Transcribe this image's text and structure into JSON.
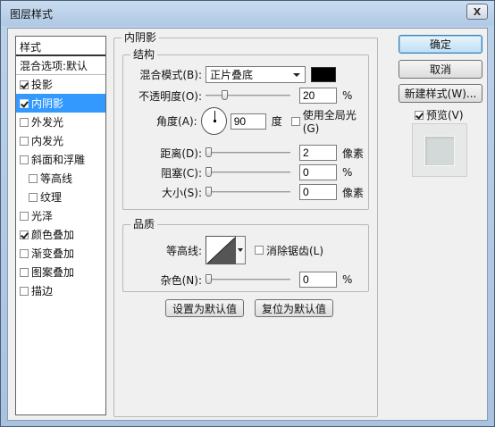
{
  "window": {
    "title": "图层样式",
    "close_label": "X"
  },
  "style_list": {
    "header": "样式",
    "blend_options": "混合选项:默认",
    "items": [
      {
        "label": "投影",
        "checked": true,
        "sub": false,
        "selected": false
      },
      {
        "label": "内阴影",
        "checked": true,
        "sub": false,
        "selected": true
      },
      {
        "label": "外发光",
        "checked": false,
        "sub": false,
        "selected": false
      },
      {
        "label": "内发光",
        "checked": false,
        "sub": false,
        "selected": false
      },
      {
        "label": "斜面和浮雕",
        "checked": false,
        "sub": false,
        "selected": false
      },
      {
        "label": "等高线",
        "checked": false,
        "sub": true,
        "selected": false
      },
      {
        "label": "纹理",
        "checked": false,
        "sub": true,
        "selected": false
      },
      {
        "label": "光泽",
        "checked": false,
        "sub": false,
        "selected": false
      },
      {
        "label": "颜色叠加",
        "checked": true,
        "sub": false,
        "selected": false
      },
      {
        "label": "渐变叠加",
        "checked": false,
        "sub": false,
        "selected": false
      },
      {
        "label": "图案叠加",
        "checked": false,
        "sub": false,
        "selected": false
      },
      {
        "label": "描边",
        "checked": false,
        "sub": false,
        "selected": false
      }
    ]
  },
  "inner_shadow": {
    "title": "内阴影",
    "structure": {
      "title": "结构",
      "blend_mode_label": "混合模式(B):",
      "blend_mode_value": "正片叠底",
      "shadow_color": "#000000",
      "opacity_label": "不透明度(O):",
      "opacity_value": "20",
      "opacity_unit": "%",
      "opacity_fraction": 0.2,
      "angle_label": "角度(A):",
      "angle_value": "90",
      "angle_unit": "度",
      "global_light_label": "使用全局光(G)",
      "global_light_checked": false,
      "distance_label": "距离(D):",
      "distance_value": "2",
      "distance_unit": "像素",
      "choke_label": "阻塞(C):",
      "choke_value": "0",
      "choke_unit": "%",
      "size_label": "大小(S):",
      "size_value": "0",
      "size_unit": "像素"
    },
    "quality": {
      "title": "品质",
      "contour_label": "等高线:",
      "antialias_label": "消除锯齿(L)",
      "antialias_checked": false,
      "noise_label": "杂色(N):",
      "noise_value": "0",
      "noise_unit": "%"
    },
    "set_default_label": "设置为默认值",
    "reset_default_label": "复位为默认值"
  },
  "buttons": {
    "ok": "确定",
    "cancel": "取消",
    "new_style": "新建样式(W)...",
    "preview_label": "预览(V)",
    "preview_checked": true
  }
}
